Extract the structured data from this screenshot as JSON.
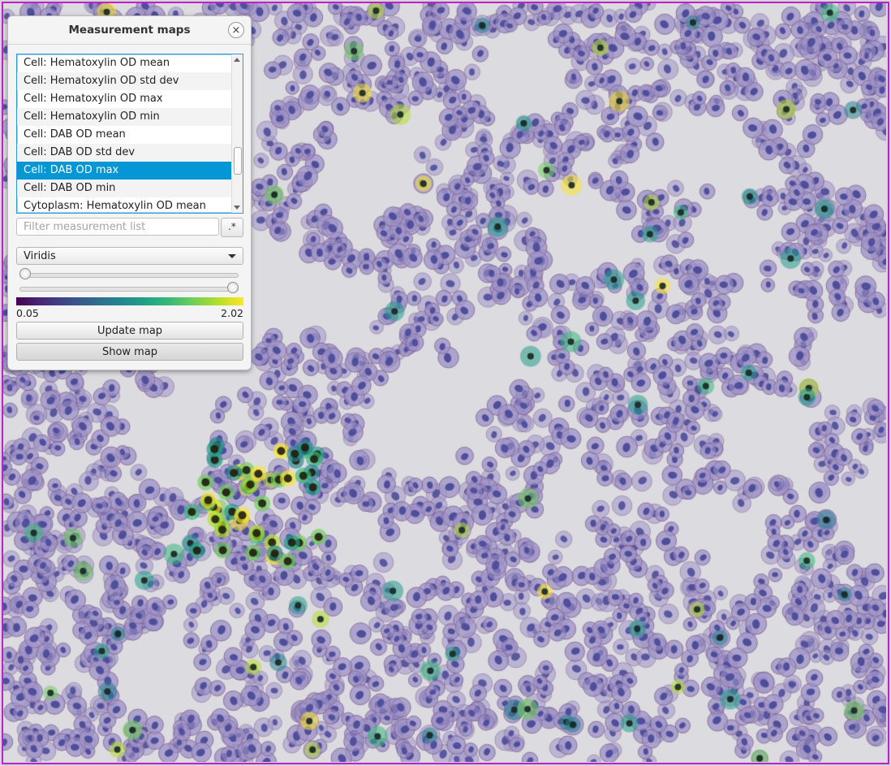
{
  "panel": {
    "title": "Measurement maps",
    "close_glyph": "×",
    "measurements": [
      "Cell: Hematoxylin OD mean",
      "Cell: Hematoxylin OD std dev",
      "Cell: Hematoxylin OD max",
      "Cell: Hematoxylin OD min",
      "Cell: DAB OD mean",
      "Cell: DAB OD std dev",
      "Cell: DAB OD max",
      "Cell: DAB OD min",
      "Cytoplasm: Hematoxylin OD mean"
    ],
    "selected_measurement": "Cell: DAB OD max",
    "filter_placeholder": "Filter measurement list",
    "filter_value": "",
    "regex_label": ".*",
    "colormap": "Viridis",
    "slider_min_position": 0.0,
    "slider_max_position": 1.0,
    "range_min": "0.05",
    "range_max": "2.02",
    "update_button": "Update map",
    "show_button": "Show map"
  },
  "icons": {
    "close": "close-icon",
    "dropdown": "chevron-down-icon"
  },
  "colors": {
    "selection": "#0596d6",
    "annotation_border": "#c020c8",
    "viridis_low": "#440154",
    "viridis_high": "#fde725",
    "nucleus_stain": "#5a5aa6"
  }
}
